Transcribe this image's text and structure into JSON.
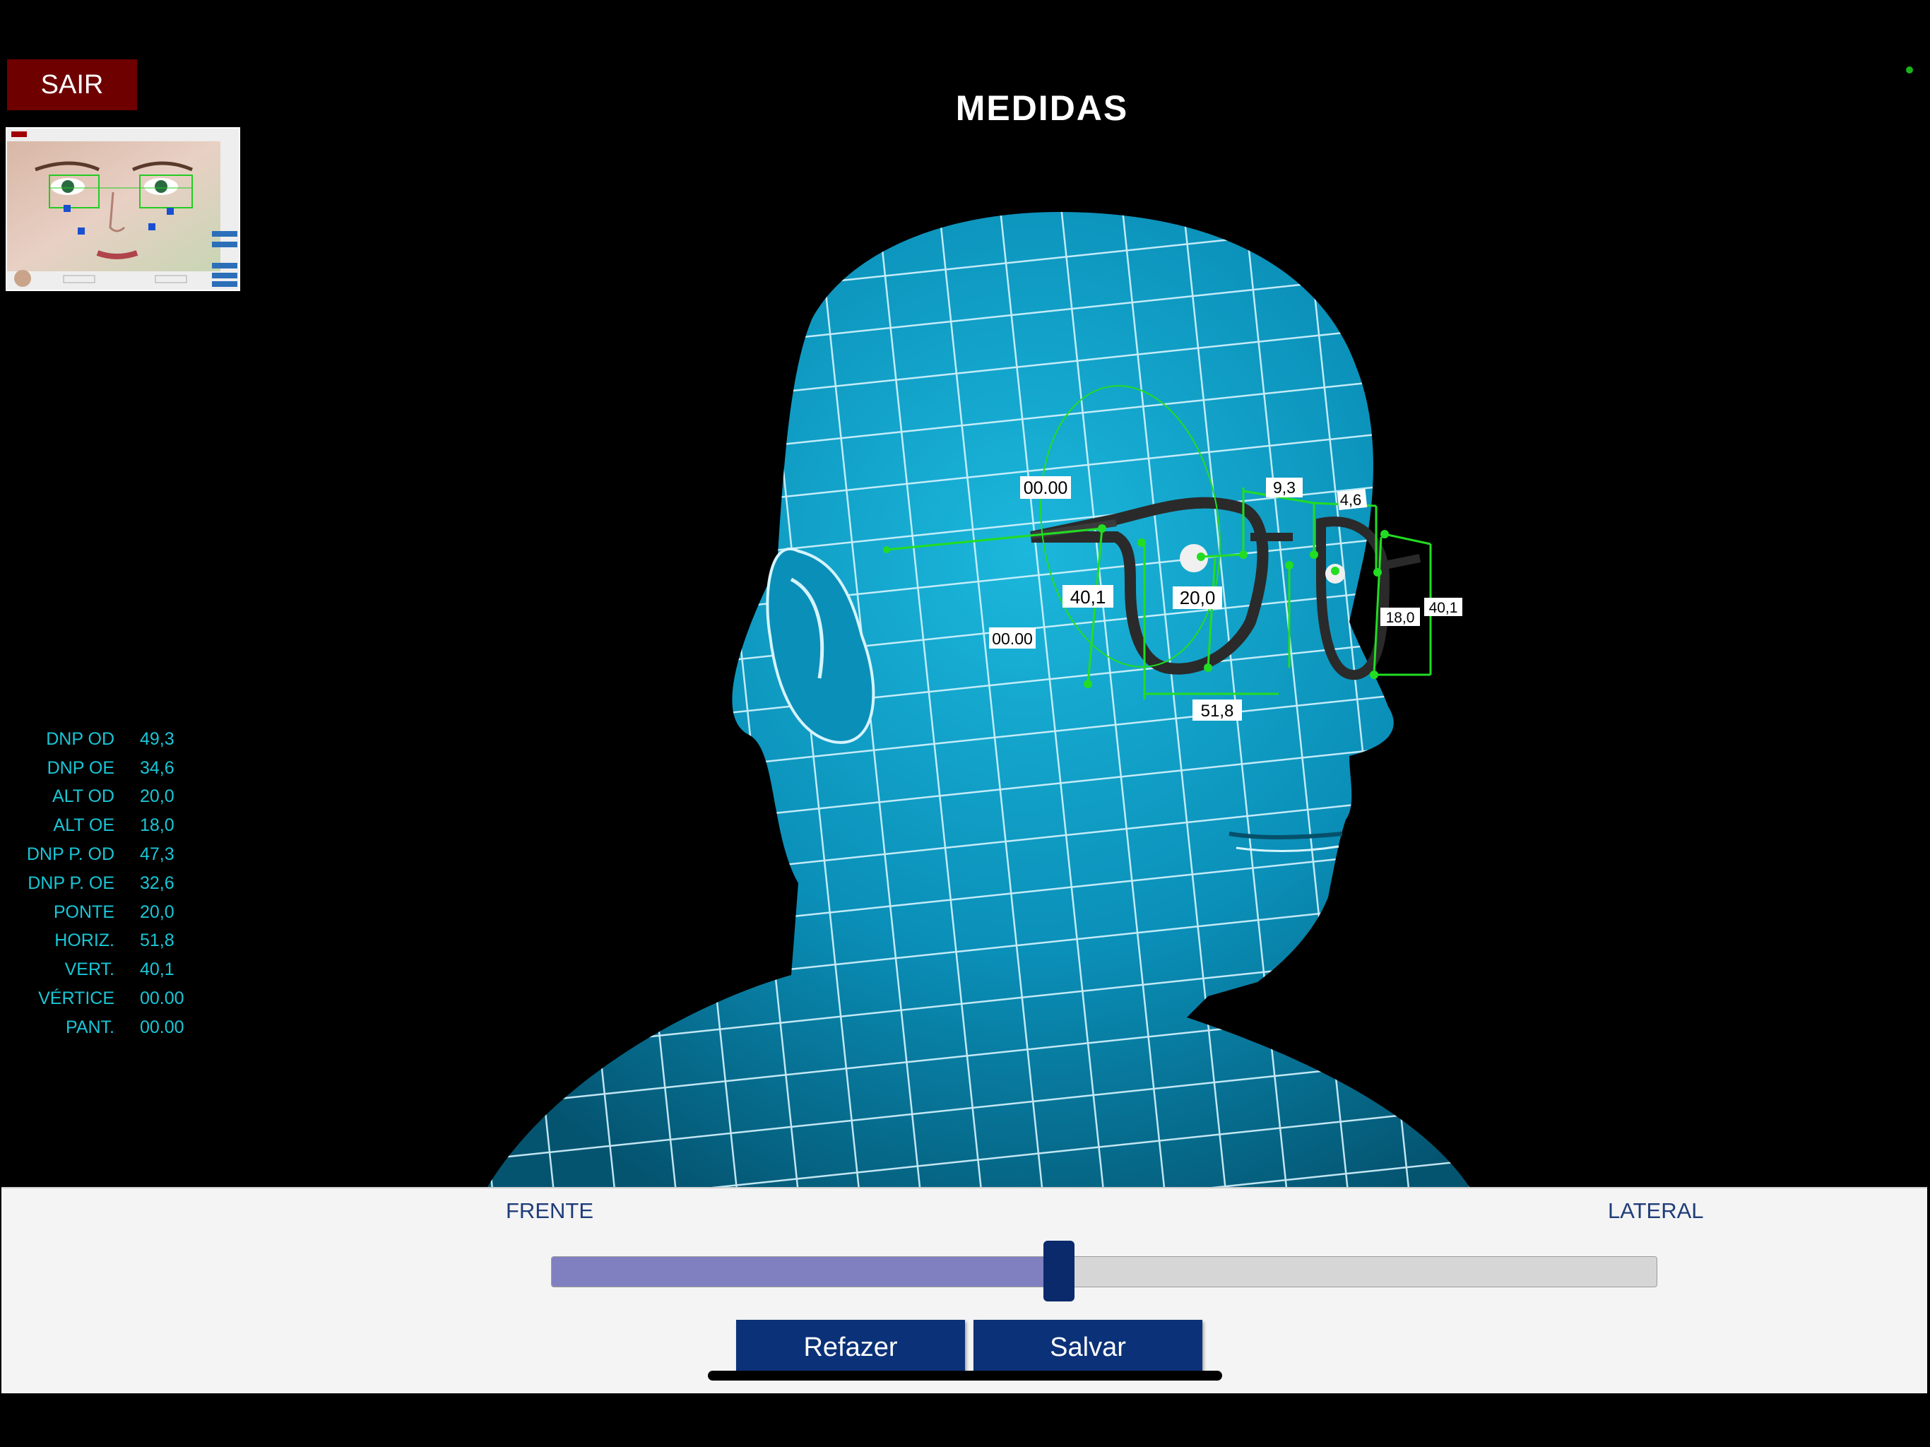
{
  "header": {
    "exit_label": "SAIR",
    "title": "MEDIDAS"
  },
  "measurements": [
    {
      "label": "DNP OD",
      "value": "49,3"
    },
    {
      "label": "DNP OE",
      "value": "34,6"
    },
    {
      "label": "ALT OD",
      "value": "20,0"
    },
    {
      "label": "ALT OE",
      "value": "18,0"
    },
    {
      "label": "DNP P. OD",
      "value": "47,3"
    },
    {
      "label": "DNP P. OE",
      "value": "32,6"
    },
    {
      "label": "PONTE",
      "value": "20,0"
    },
    {
      "label": "HORIZ.",
      "value": "51,8"
    },
    {
      "label": "VERT.",
      "value": "40,1"
    },
    {
      "label": "VÉRTICE",
      "value": "00.00"
    },
    {
      "label": "PANT.",
      "value": "00.00"
    }
  ],
  "model_labels": {
    "vertex_top": "00.00",
    "pant": "00.00",
    "vert": "40,1",
    "alt": "20,0",
    "horiz": "51,8",
    "temple_a": "9,3",
    "temple_b": "4,6",
    "side_alt": "18,0",
    "side_vert": "40,1"
  },
  "view_control": {
    "left_label": "FRENTE",
    "right_label": "LATERAL",
    "position": 0.46
  },
  "actions": {
    "redo_label": "Refazer",
    "save_label": "Salvar"
  },
  "colors": {
    "accent": "#0b3178",
    "exit": "#6e0000",
    "measurement_text": "#19c6d6",
    "mesh": "#0a8fb8",
    "guide_lines": "#22dd22"
  }
}
